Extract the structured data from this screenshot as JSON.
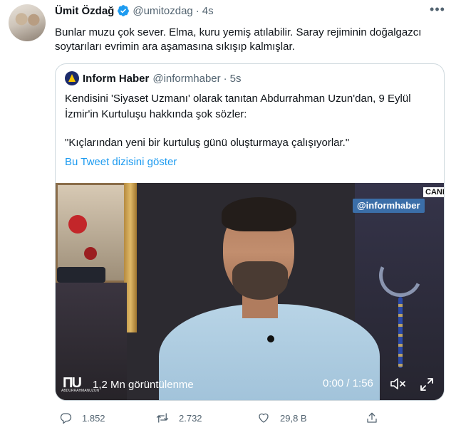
{
  "tweet": {
    "author_name": "Ümit Özdağ",
    "author_handle": "@umitozdag",
    "separator": "·",
    "time": "4s",
    "text": "Bunlar muzu çok sever. Elma, kuru yemiş atılabilir. Saray rejiminin doğalgazcı soytarıları evrimin ara aşamasına sıkışıp kalmışlar."
  },
  "quote": {
    "author_name": "Inform Haber",
    "author_handle": "@informhaber",
    "separator": "·",
    "time": "5s",
    "text": "Kendisini 'Siyaset Uzmanı' olarak tanıtan Abdurrahman Uzun'dan, 9 Eylül İzmir'in Kurtuluşu hakkında şok sözler:",
    "quoted_line": "\"Kıçlarından yeni bir kurtuluş günü oluşturmaya çalışıyorlar.\"",
    "thread_link": "Bu Tweet dizisini göster"
  },
  "video": {
    "channel_corner": "CANI",
    "overlay_handle": "@informhaber",
    "creator_mark": "ΠU",
    "creator_sub": "ABDURRAHMANUZUN",
    "views": "1,2 Mn görüntülenme",
    "time": "0:00 / 1:56"
  },
  "actions": {
    "replies": "1.852",
    "retweets": "2.732",
    "likes": "29,8 B"
  },
  "icons": {
    "verified": "verified-badge-icon",
    "more": "more-options-icon",
    "reply": "reply-icon",
    "retweet": "retweet-icon",
    "like": "heart-icon",
    "share": "share-icon",
    "mute": "volume-muted-icon",
    "fullscreen": "fullscreen-icon"
  },
  "colors": {
    "accent": "#1d9bf0",
    "secondary_text": "#536471",
    "border": "#cfd9de"
  }
}
